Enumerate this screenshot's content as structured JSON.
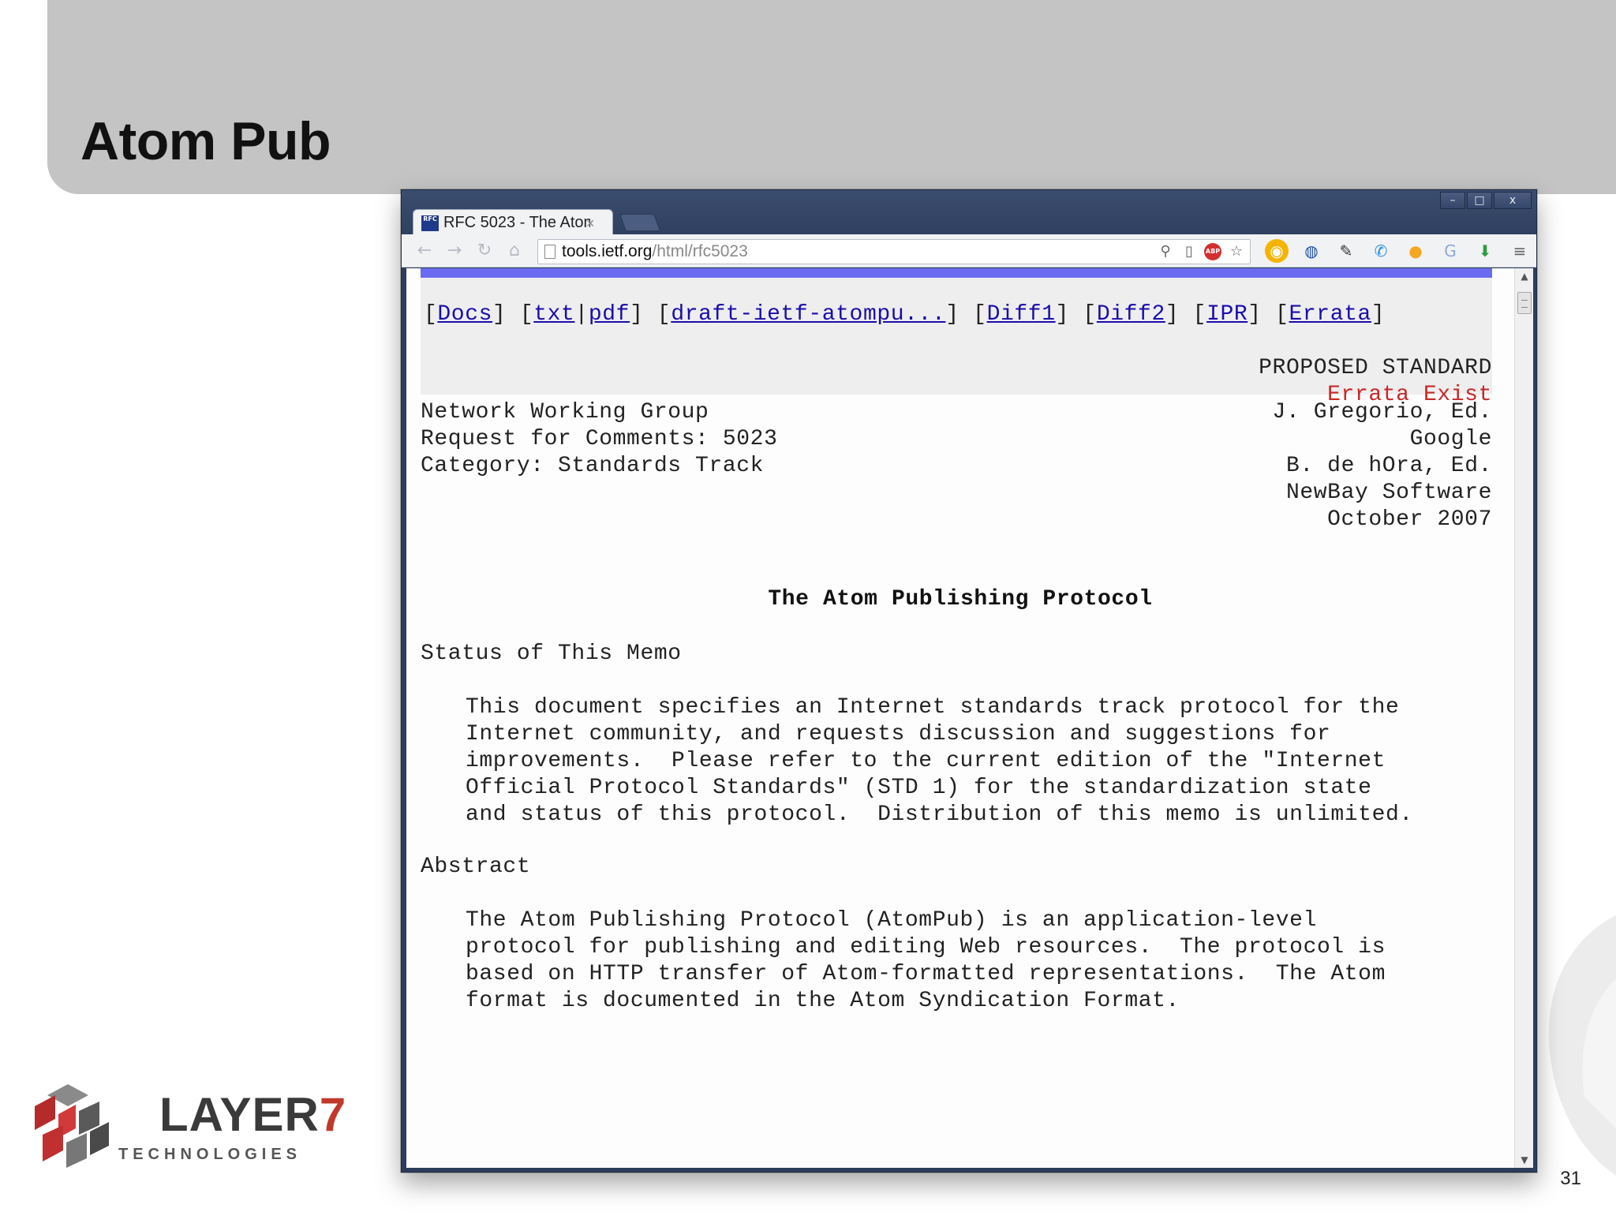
{
  "slide": {
    "title": "Atom Pub",
    "page_number": "31",
    "logo": {
      "main": "LAYER",
      "seven": "7",
      "sub": "TECHNOLOGIES"
    }
  },
  "browser": {
    "tab_title": "RFC 5023 - The Atom",
    "tab_favicon": "RFC",
    "url_host": "tools.ietf.org",
    "url_path": "/html/rfc5023",
    "window_controls": {
      "minimize": "–",
      "maximize": "□",
      "close": "x"
    }
  },
  "rfc": {
    "links": [
      {
        "label": "Docs"
      },
      {
        "label": "txt"
      },
      {
        "label": "pdf"
      },
      {
        "label": "draft-ietf-atompu..."
      },
      {
        "label": "Diff1"
      },
      {
        "label": "Diff2"
      },
      {
        "label": "IPR"
      },
      {
        "label": "Errata"
      }
    ],
    "status": "PROPOSED STANDARD",
    "errata": "Errata Exist",
    "header_left": [
      "Network Working Group",
      "Request for Comments: 5023",
      "Category: Standards Track"
    ],
    "header_right": [
      "J. Gregorio, Ed.",
      "Google",
      "B. de hOra, Ed.",
      "NewBay Software",
      "October 2007"
    ],
    "title": "The Atom Publishing Protocol",
    "status_heading": "Status of This Memo",
    "status_lines": [
      "This document specifies an Internet standards track protocol for the",
      "Internet community, and requests discussion and suggestions for",
      "improvements.  Please refer to the current edition of the \"Internet",
      "Official Protocol Standards\" (STD 1) for the standardization state",
      "and status of this protocol.  Distribution of this memo is unlimited."
    ],
    "abstract_heading": "Abstract",
    "abstract_lines": [
      "The Atom Publishing Protocol (AtomPub) is an application-level",
      "protocol for publishing and editing Web resources.  The protocol is",
      "based on HTTP transfer of Atom-formatted representations.  The Atom",
      "format is documented in the Atom Syndication Format."
    ]
  }
}
